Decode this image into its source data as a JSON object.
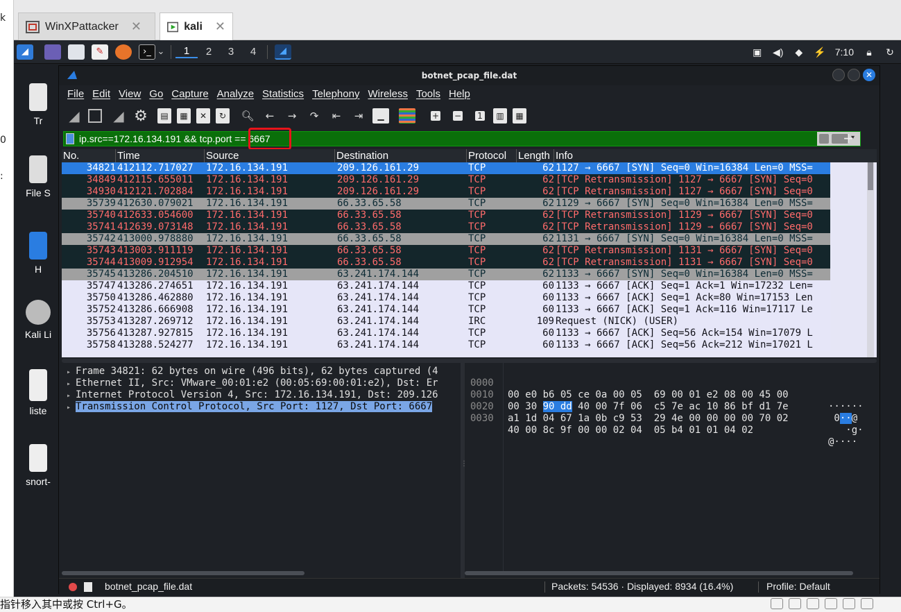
{
  "host": {
    "left_edge_chars": [
      "k",
      "0",
      ":"
    ],
    "tabs": [
      {
        "label": "WinXPattacker",
        "active": false
      },
      {
        "label": "kali",
        "active": true
      }
    ],
    "status_text": "指针移入其中或按 Ctrl+G。"
  },
  "kali_panel": {
    "workspaces": [
      "1",
      "2",
      "3",
      "4"
    ],
    "active_workspace": "1",
    "clock": "7:10"
  },
  "desktop_icons": [
    "Tr",
    "File S",
    "H",
    "Kali Li",
    "liste",
    "snort-"
  ],
  "wireshark": {
    "title": "botnet_pcap_file.dat",
    "menu": [
      "File",
      "Edit",
      "View",
      "Go",
      "Capture",
      "Analyze",
      "Statistics",
      "Telephony",
      "Wireless",
      "Tools",
      "Help"
    ],
    "filter": "ip.src==172.16.134.191 && tcp.port == 6667",
    "columns": [
      "No.",
      "Time",
      "Source",
      "Destination",
      "Protocol",
      "Length",
      "Info"
    ],
    "packets": [
      {
        "no": "34821",
        "time": "412112.717027",
        "src": "172.16.134.191",
        "dst": "209.126.161.29",
        "proto": "TCP",
        "len": "62",
        "info": "1127 → 6667 [SYN] Seq=0 Win=16384 Len=0 MSS=",
        "style": "sel"
      },
      {
        "no": "34849",
        "time": "412115.655011",
        "src": "172.16.134.191",
        "dst": "209.126.161.29",
        "proto": "TCP",
        "len": "62",
        "info": "[TCP Retransmission] 1127 → 6667 [SYN] Seq=0",
        "style": "retrans"
      },
      {
        "no": "34930",
        "time": "412121.702884",
        "src": "172.16.134.191",
        "dst": "209.126.161.29",
        "proto": "TCP",
        "len": "62",
        "info": "[TCP Retransmission] 1127 → 6667 [SYN] Seq=0",
        "style": "retrans"
      },
      {
        "no": "35739",
        "time": "412630.079021",
        "src": "172.16.134.191",
        "dst": "66.33.65.58",
        "proto": "TCP",
        "len": "62",
        "info": "1129 → 6667 [SYN] Seq=0 Win=16384 Len=0 MSS=",
        "style": "gray"
      },
      {
        "no": "35740",
        "time": "412633.054600",
        "src": "172.16.134.191",
        "dst": "66.33.65.58",
        "proto": "TCP",
        "len": "62",
        "info": "[TCP Retransmission] 1129 → 6667 [SYN] Seq=0",
        "style": "retrans"
      },
      {
        "no": "35741",
        "time": "412639.073148",
        "src": "172.16.134.191",
        "dst": "66.33.65.58",
        "proto": "TCP",
        "len": "62",
        "info": "[TCP Retransmission] 1129 → 6667 [SYN] Seq=0",
        "style": "retrans"
      },
      {
        "no": "35742",
        "time": "413000.978880",
        "src": "172.16.134.191",
        "dst": "66.33.65.58",
        "proto": "TCP",
        "len": "62",
        "info": "1131 → 6667 [SYN] Seq=0 Win=16384 Len=0 MSS=",
        "style": "gray"
      },
      {
        "no": "35743",
        "time": "413003.911119",
        "src": "172.16.134.191",
        "dst": "66.33.65.58",
        "proto": "TCP",
        "len": "62",
        "info": "[TCP Retransmission] 1131 → 6667 [SYN] Seq=0",
        "style": "retrans"
      },
      {
        "no": "35744",
        "time": "413009.912954",
        "src": "172.16.134.191",
        "dst": "66.33.65.58",
        "proto": "TCP",
        "len": "62",
        "info": "[TCP Retransmission] 1131 → 6667 [SYN] Seq=0",
        "style": "retrans"
      },
      {
        "no": "35745",
        "time": "413286.204510",
        "src": "172.16.134.191",
        "dst": "63.241.174.144",
        "proto": "TCP",
        "len": "62",
        "info": "1133 → 6667 [SYN] Seq=0 Win=16384 Len=0 MSS=",
        "style": "gray"
      },
      {
        "no": "35747",
        "time": "413286.274651",
        "src": "172.16.134.191",
        "dst": "63.241.174.144",
        "proto": "TCP",
        "len": "60",
        "info": "1133 → 6667 [ACK] Seq=1 Ack=1 Win=17232 Len=",
        "style": "light"
      },
      {
        "no": "35750",
        "time": "413286.462880",
        "src": "172.16.134.191",
        "dst": "63.241.174.144",
        "proto": "TCP",
        "len": "60",
        "info": "1133 → 6667 [ACK] Seq=1 Ack=80 Win=17153 Len",
        "style": "light"
      },
      {
        "no": "35752",
        "time": "413286.666908",
        "src": "172.16.134.191",
        "dst": "63.241.174.144",
        "proto": "TCP",
        "len": "60",
        "info": "1133 → 6667 [ACK] Seq=1 Ack=116 Win=17117 Le",
        "style": "light"
      },
      {
        "no": "35753",
        "time": "413287.269712",
        "src": "172.16.134.191",
        "dst": "63.241.174.144",
        "proto": "IRC",
        "len": "109",
        "info": "Request (NICK) (USER)",
        "style": "light"
      },
      {
        "no": "35756",
        "time": "413287.927815",
        "src": "172.16.134.191",
        "dst": "63.241.174.144",
        "proto": "TCP",
        "len": "60",
        "info": "1133 → 6667 [ACK] Seq=56 Ack=154 Win=17079 L",
        "style": "light"
      },
      {
        "no": "35758",
        "time": "413288.524277",
        "src": "172.16.134.191",
        "dst": "63.241.174.144",
        "proto": "TCP",
        "len": "60",
        "info": "1133 → 6667 [ACK] Seq=56 Ack=212 Win=17021 L",
        "style": "light"
      }
    ],
    "details": [
      {
        "text": "Frame 34821: 62 bytes on wire (496 bits), 62 bytes captured (4",
        "selected": false
      },
      {
        "text": "Ethernet II, Src: VMware_00:01:e2 (00:05:69:00:01:e2), Dst: Er",
        "selected": false
      },
      {
        "text": "Internet Protocol Version 4, Src: 172.16.134.191, Dst: 209.126",
        "selected": false
      },
      {
        "text": "Transmission Control Protocol, Src Port: 1127, Dst Port: 6667",
        "selected": true
      }
    ],
    "bytes": [
      {
        "offset": "0000",
        "hex": "00 e0 b6 05 ce 0a 00 05  69 00 01 e2 08 00 45 00",
        "ascii": "······"
      },
      {
        "offset": "0010",
        "hex_pre": "00 30 ",
        "hex_hl": "90 dd",
        "hex_post": " 40 00 7f 06  c5 7e ac 10 86 bf d1 7e",
        "ascii_pre": " 0",
        "ascii_hl": "··",
        "ascii_post": "@"
      },
      {
        "offset": "0020",
        "hex": "a1 1d 04 67 1a 0b c9 53  29 4e 00 00 00 00 70 02",
        "ascii": "   ·g·"
      },
      {
        "offset": "0030",
        "hex": "40 00 8c 9f 00 00 02 04  05 b4 01 01 04 02",
        "ascii": "@····"
      }
    ],
    "status": {
      "file": "botnet_pcap_file.dat",
      "packets": "Packets: 54536 · Displayed: 8934 (16.4%)",
      "profile": "Profile: Default"
    }
  }
}
